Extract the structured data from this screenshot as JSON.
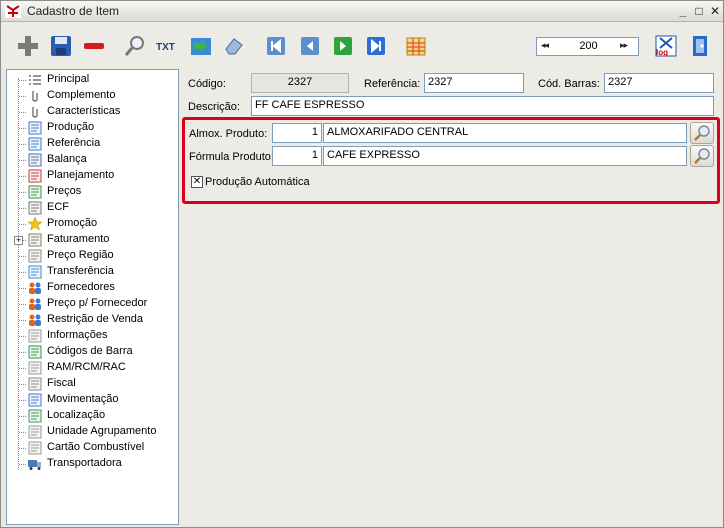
{
  "window": {
    "title": "Cadastro de Item"
  },
  "toolbar": {
    "nav_value": "200",
    "nav_first": "◂◂",
    "nav_last": "▸▸",
    "icons": [
      "add-icon",
      "save-icon",
      "delete-icon",
      "search-icon",
      "txt-export-icon",
      "refresh-icon",
      "eraser-icon",
      "first-record-icon",
      "previous-record-icon",
      "next-record-icon",
      "last-record-icon",
      "calendar-grid-icon",
      "log-icon",
      "exit-icon"
    ]
  },
  "tree": {
    "items": [
      {
        "label": "Principal",
        "icon": "list-icon"
      },
      {
        "label": "Complemento",
        "icon": "clip-icon"
      },
      {
        "label": "Características",
        "icon": "clip-icon"
      },
      {
        "label": "Produção",
        "icon": "production-icon"
      },
      {
        "label": "Referência",
        "icon": "reference-icon"
      },
      {
        "label": "Balança",
        "icon": "scale-icon"
      },
      {
        "label": "Planejamento",
        "icon": "planning-icon"
      },
      {
        "label": "Preços",
        "icon": "price-icon"
      },
      {
        "label": "ECF",
        "icon": "printer-icon"
      },
      {
        "label": "Promoção",
        "icon": "star-icon"
      },
      {
        "label": "Faturamento",
        "icon": "billing-icon"
      },
      {
        "label": "Preço Região",
        "icon": "region-price-icon"
      },
      {
        "label": "Transferência",
        "icon": "transfer-icon"
      },
      {
        "label": "Fornecedores",
        "icon": "suppliers-icon"
      },
      {
        "label": "Preço p/ Fornecedor",
        "icon": "supplier-price-icon"
      },
      {
        "label": "Restrição de Venda",
        "icon": "restriction-icon"
      },
      {
        "label": "Informações",
        "icon": "info-icon"
      },
      {
        "label": "Códigos de Barra",
        "icon": "barcode-icon"
      },
      {
        "label": "RAM/RCM/RAC",
        "icon": "document-icon"
      },
      {
        "label": "Fiscal",
        "icon": "fiscal-icon"
      },
      {
        "label": "Movimentação",
        "icon": "movement-icon"
      },
      {
        "label": "Localização",
        "icon": "location-icon"
      },
      {
        "label": "Unidade Agrupamento",
        "icon": "document-icon"
      },
      {
        "label": "Cartão Combustível",
        "icon": "document-icon"
      },
      {
        "label": "Transportadora",
        "icon": "truck-icon"
      }
    ],
    "expand_symbol": "+"
  },
  "form": {
    "codigo_label": "Código:",
    "codigo_value": "2327",
    "referencia_label": "Referência:",
    "referencia_value": "2327",
    "cod_barras_label": "Cód. Barras:",
    "cod_barras_value": "2327",
    "descricao_label": "Descrição:",
    "descricao_value": "FF CAFE ESPRESSO",
    "almox_label": "Almox. Produto:",
    "almox_code": "1",
    "almox_name": "ALMOXARIFADO CENTRAL",
    "formula_label": "Fórmula Produto:",
    "formula_code": "1",
    "formula_name": "CAFE EXPRESSO",
    "producao_auto_label": "Produção Automática",
    "producao_auto_checked": true
  },
  "colors": {
    "highlight": "#d9001b"
  }
}
